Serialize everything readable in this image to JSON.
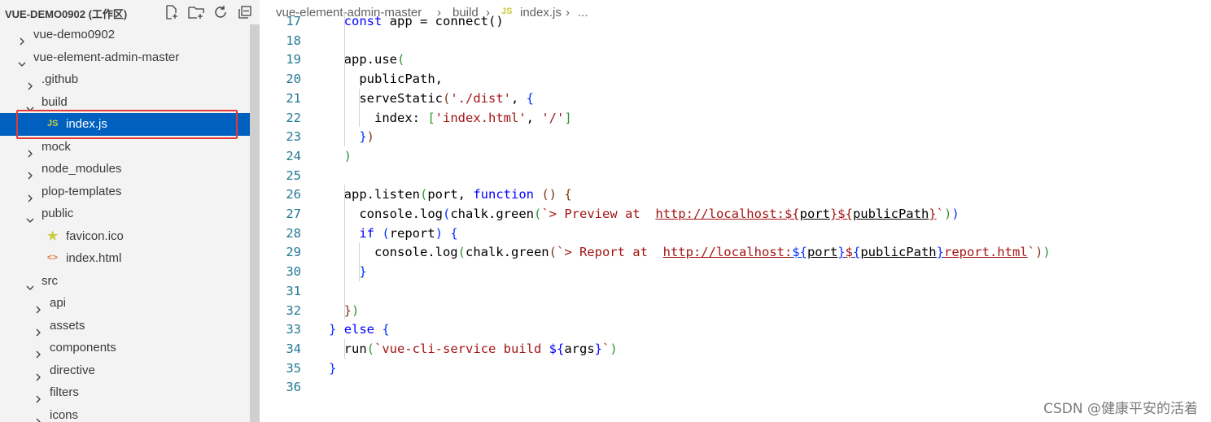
{
  "sidebar": {
    "title": "VUE-DEMO0902 (工作区)",
    "actions": [
      "new-file-icon",
      "new-folder-icon",
      "refresh-icon",
      "collapse-all-icon"
    ],
    "items": [
      {
        "label": "vue-demo0902",
        "depth": 0,
        "type": "folder",
        "expanded": false
      },
      {
        "label": "vue-element-admin-master",
        "depth": 0,
        "type": "folder",
        "expanded": true
      },
      {
        "label": ".github",
        "depth": 1,
        "type": "folder",
        "expanded": false
      },
      {
        "label": "build",
        "depth": 1,
        "type": "folder",
        "expanded": true
      },
      {
        "label": "index.js",
        "depth": 2,
        "type": "js",
        "icon_text": "JS",
        "selected": true
      },
      {
        "label": "mock",
        "depth": 1,
        "type": "folder",
        "expanded": false
      },
      {
        "label": "node_modules",
        "depth": 1,
        "type": "folder",
        "expanded": false
      },
      {
        "label": "plop-templates",
        "depth": 1,
        "type": "folder",
        "expanded": false
      },
      {
        "label": "public",
        "depth": 1,
        "type": "folder",
        "expanded": true
      },
      {
        "label": "favicon.ico",
        "depth": 2,
        "type": "star"
      },
      {
        "label": "index.html",
        "depth": 2,
        "type": "html",
        "icon_text": "<>"
      },
      {
        "label": "src",
        "depth": 1,
        "type": "folder",
        "expanded": true
      },
      {
        "label": "api",
        "depth": 2,
        "type": "folder",
        "expanded": false
      },
      {
        "label": "assets",
        "depth": 2,
        "type": "folder",
        "expanded": false
      },
      {
        "label": "components",
        "depth": 2,
        "type": "folder",
        "expanded": false
      },
      {
        "label": "directive",
        "depth": 2,
        "type": "folder",
        "expanded": false
      },
      {
        "label": "filters",
        "depth": 2,
        "type": "folder",
        "expanded": false
      },
      {
        "label": "icons",
        "depth": 2,
        "type": "folder",
        "expanded": false
      }
    ]
  },
  "breadcrumb": {
    "parts": [
      "vue-element-admin-master",
      "build",
      "index.js",
      "..."
    ],
    "file_icon_text": "JS"
  },
  "editor": {
    "lines": [
      {
        "n": "17",
        "segs": [
          [
            "tx",
            "  "
          ],
          [
            "k",
            "const"
          ],
          [
            "tx",
            " app = connect()"
          ]
        ]
      },
      {
        "n": "18",
        "segs": []
      },
      {
        "n": "19",
        "segs": [
          [
            "tx",
            "  app.use"
          ],
          [
            "br2",
            "("
          ]
        ]
      },
      {
        "n": "20",
        "segs": [
          [
            "tx",
            "    publicPath,"
          ]
        ]
      },
      {
        "n": "21",
        "segs": [
          [
            "tx",
            "    serveStatic"
          ],
          [
            "br3",
            "("
          ],
          [
            "s",
            "'./dist'"
          ],
          [
            "tx",
            ", "
          ],
          [
            "br1",
            "{"
          ]
        ]
      },
      {
        "n": "22",
        "segs": [
          [
            "tx",
            "      index: "
          ],
          [
            "br2",
            "["
          ],
          [
            "s",
            "'index.html'"
          ],
          [
            "tx",
            ", "
          ],
          [
            "s",
            "'/'"
          ],
          [
            "br2",
            "]"
          ]
        ]
      },
      {
        "n": "23",
        "segs": [
          [
            "tx",
            "    "
          ],
          [
            "br1",
            "}"
          ],
          [
            "br3",
            ")"
          ]
        ]
      },
      {
        "n": "24",
        "segs": [
          [
            "tx",
            "  "
          ],
          [
            "br2",
            ")"
          ]
        ]
      },
      {
        "n": "25",
        "segs": []
      },
      {
        "n": "26",
        "segs": [
          [
            "tx",
            "  app.listen"
          ],
          [
            "br2",
            "("
          ],
          [
            "tx",
            "port, "
          ],
          [
            "k",
            "function"
          ],
          [
            "tx",
            " "
          ],
          [
            "br3",
            "()"
          ],
          [
            "tx",
            " "
          ],
          [
            "br3",
            "{"
          ]
        ]
      },
      {
        "n": "27",
        "segs": [
          [
            "tx",
            "    console.log"
          ],
          [
            "br1",
            "("
          ],
          [
            "tx",
            "chalk.green"
          ],
          [
            "br2",
            "("
          ],
          [
            "s",
            "`> Preview at  "
          ],
          [
            "su",
            "http://localhost:${"
          ],
          [
            "tu",
            "port"
          ],
          [
            "su",
            "}${"
          ],
          [
            "tu",
            "publicPath"
          ],
          [
            "su",
            "}"
          ],
          [
            "s",
            "`"
          ],
          [
            "br2",
            ")"
          ],
          [
            "br1",
            ")"
          ]
        ]
      },
      {
        "n": "28",
        "segs": [
          [
            "tx",
            "    "
          ],
          [
            "k",
            "if"
          ],
          [
            "tx",
            " "
          ],
          [
            "br1",
            "("
          ],
          [
            "tx",
            "report"
          ],
          [
            "br1",
            ")"
          ],
          [
            "tx",
            " "
          ],
          [
            "br1",
            "{"
          ]
        ]
      },
      {
        "n": "29",
        "segs": [
          [
            "tx",
            "      console.log"
          ],
          [
            "br2",
            "("
          ],
          [
            "tx",
            "chalk.green"
          ],
          [
            "br3",
            "("
          ],
          [
            "s",
            "`> Report at  "
          ],
          [
            "su",
            "http://localhost:"
          ],
          [
            "bu",
            "${"
          ],
          [
            "tu",
            "port"
          ],
          [
            "bu",
            "}"
          ],
          [
            "su",
            "$"
          ],
          [
            "bu",
            "{"
          ],
          [
            "tu",
            "publicPath"
          ],
          [
            "bu",
            "}"
          ],
          [
            "su",
            "report.html"
          ],
          [
            "s",
            "`"
          ],
          [
            "br3",
            ")"
          ],
          [
            "br2",
            ")"
          ]
        ]
      },
      {
        "n": "30",
        "segs": [
          [
            "tx",
            "    "
          ],
          [
            "br1",
            "}"
          ]
        ]
      },
      {
        "n": "31",
        "segs": []
      },
      {
        "n": "32",
        "segs": [
          [
            "tx",
            "  "
          ],
          [
            "br3",
            "}"
          ],
          [
            "br2",
            ")"
          ]
        ]
      },
      {
        "n": "33",
        "segs": [
          [
            "br1",
            "}"
          ],
          [
            "tx",
            " "
          ],
          [
            "k",
            "else"
          ],
          [
            "tx",
            " "
          ],
          [
            "br1",
            "{"
          ]
        ]
      },
      {
        "n": "34",
        "segs": [
          [
            "tx",
            "  run"
          ],
          [
            "br2",
            "("
          ],
          [
            "s",
            "`vue-cli-service build "
          ],
          [
            "k",
            "${"
          ],
          [
            "tx",
            "args"
          ],
          [
            "k",
            "}"
          ],
          [
            "s",
            "`"
          ],
          [
            "br2",
            ")"
          ]
        ]
      },
      {
        "n": "35",
        "segs": [
          [
            "br1",
            "}"
          ]
        ]
      },
      {
        "n": "36",
        "segs": []
      }
    ]
  },
  "watermark": "CSDN @健康平安的活着",
  "colors": {
    "selection": "#0060c0",
    "highlight_box": "#e53935",
    "line_number": "#237893",
    "keyword": "#0000ff",
    "string": "#a31515",
    "js_icon": "#cbcb41"
  }
}
